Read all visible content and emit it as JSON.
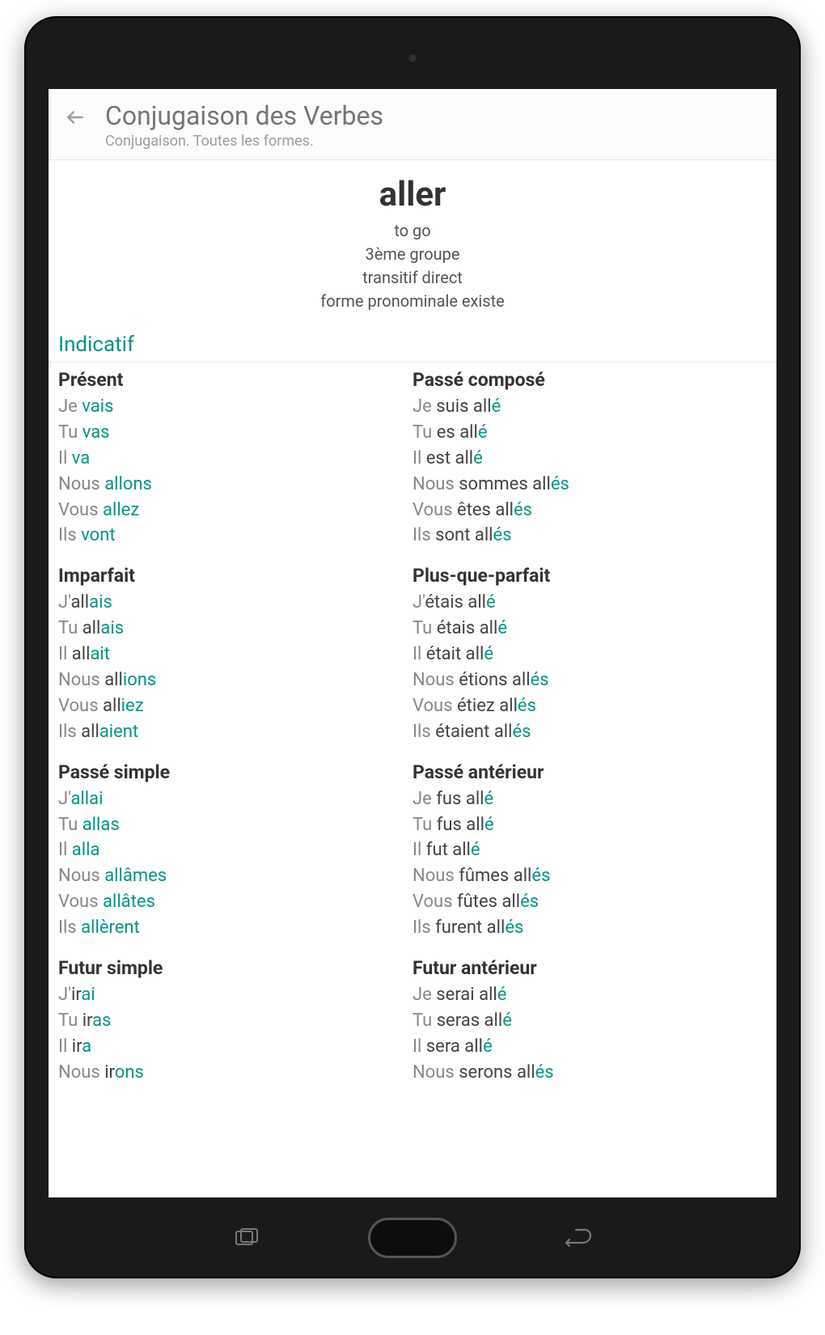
{
  "header": {
    "title": "Conjugaison des Verbes",
    "subtitle": "Conjugaison. Toutes les formes."
  },
  "verb": {
    "infinitive": "aller",
    "translation": "to go",
    "group": "3ème groupe",
    "transitivity": "transitif direct",
    "pronominal": "forme pronominale existe"
  },
  "mood": "Indicatif",
  "tenses": [
    {
      "left": {
        "name": "Présent",
        "rows": [
          {
            "pronoun": "Je",
            "parts": [
              {
                "t": "vais",
                "c": "verb-teal"
              }
            ]
          },
          {
            "pronoun": "Tu",
            "parts": [
              {
                "t": "vas",
                "c": "verb-teal"
              }
            ]
          },
          {
            "pronoun": "Il",
            "parts": [
              {
                "t": "va",
                "c": "verb-teal"
              }
            ]
          },
          {
            "pronoun": "Nous",
            "parts": [
              {
                "t": "allons",
                "c": "verb-teal"
              }
            ]
          },
          {
            "pronoun": "Vous",
            "parts": [
              {
                "t": "allez",
                "c": "verb-teal"
              }
            ]
          },
          {
            "pronoun": "Ils",
            "parts": [
              {
                "t": "vont",
                "c": "verb-teal"
              }
            ]
          }
        ]
      },
      "right": {
        "name": "Passé composé",
        "rows": [
          {
            "pronoun": "Je",
            "parts": [
              {
                "t": "suis",
                "c": "aux"
              },
              {
                "t": " all",
                "c": "stem"
              },
              {
                "t": "é",
                "c": "ending"
              }
            ]
          },
          {
            "pronoun": "Tu",
            "parts": [
              {
                "t": "es",
                "c": "aux"
              },
              {
                "t": " all",
                "c": "stem"
              },
              {
                "t": "é",
                "c": "ending"
              }
            ]
          },
          {
            "pronoun": "Il",
            "parts": [
              {
                "t": "est",
                "c": "aux"
              },
              {
                "t": " all",
                "c": "stem"
              },
              {
                "t": "é",
                "c": "ending"
              }
            ]
          },
          {
            "pronoun": "Nous",
            "parts": [
              {
                "t": "sommes",
                "c": "aux"
              },
              {
                "t": " all",
                "c": "stem"
              },
              {
                "t": "és",
                "c": "ending"
              }
            ]
          },
          {
            "pronoun": "Vous",
            "parts": [
              {
                "t": "êtes",
                "c": "aux"
              },
              {
                "t": " all",
                "c": "stem"
              },
              {
                "t": "és",
                "c": "ending"
              }
            ]
          },
          {
            "pronoun": "Ils",
            "parts": [
              {
                "t": "sont",
                "c": "aux"
              },
              {
                "t": " all",
                "c": "stem"
              },
              {
                "t": "és",
                "c": "ending"
              }
            ]
          }
        ]
      }
    },
    {
      "left": {
        "name": "Imparfait",
        "rows": [
          {
            "pronoun": "J'",
            "parts": [
              {
                "t": "all",
                "c": "stem"
              },
              {
                "t": "ais",
                "c": "ending"
              }
            ]
          },
          {
            "pronoun": "Tu",
            "parts": [
              {
                "t": "all",
                "c": "stem"
              },
              {
                "t": "ais",
                "c": "ending"
              }
            ]
          },
          {
            "pronoun": "Il",
            "parts": [
              {
                "t": "all",
                "c": "stem"
              },
              {
                "t": "ait",
                "c": "ending"
              }
            ]
          },
          {
            "pronoun": "Nous",
            "parts": [
              {
                "t": "all",
                "c": "stem"
              },
              {
                "t": "ions",
                "c": "ending"
              }
            ]
          },
          {
            "pronoun": "Vous",
            "parts": [
              {
                "t": "all",
                "c": "stem"
              },
              {
                "t": "iez",
                "c": "ending"
              }
            ]
          },
          {
            "pronoun": "Ils",
            "parts": [
              {
                "t": "all",
                "c": "stem"
              },
              {
                "t": "aient",
                "c": "ending"
              }
            ]
          }
        ]
      },
      "right": {
        "name": "Plus-que-parfait",
        "rows": [
          {
            "pronoun": "J'",
            "parts": [
              {
                "t": "étais",
                "c": "aux"
              },
              {
                "t": " all",
                "c": "stem"
              },
              {
                "t": "é",
                "c": "ending"
              }
            ]
          },
          {
            "pronoun": "Tu",
            "parts": [
              {
                "t": "étais",
                "c": "aux"
              },
              {
                "t": " all",
                "c": "stem"
              },
              {
                "t": "é",
                "c": "ending"
              }
            ]
          },
          {
            "pronoun": "Il",
            "parts": [
              {
                "t": "était",
                "c": "aux"
              },
              {
                "t": " all",
                "c": "stem"
              },
              {
                "t": "é",
                "c": "ending"
              }
            ]
          },
          {
            "pronoun": "Nous",
            "parts": [
              {
                "t": "étions",
                "c": "aux"
              },
              {
                "t": " all",
                "c": "stem"
              },
              {
                "t": "és",
                "c": "ending"
              }
            ]
          },
          {
            "pronoun": "Vous",
            "parts": [
              {
                "t": "étiez",
                "c": "aux"
              },
              {
                "t": " all",
                "c": "stem"
              },
              {
                "t": "és",
                "c": "ending"
              }
            ]
          },
          {
            "pronoun": "Ils",
            "parts": [
              {
                "t": "étaient",
                "c": "aux"
              },
              {
                "t": " all",
                "c": "stem"
              },
              {
                "t": "és",
                "c": "ending"
              }
            ]
          }
        ]
      }
    },
    {
      "left": {
        "name": "Passé simple",
        "rows": [
          {
            "pronoun": "J'",
            "parts": [
              {
                "t": "allai",
                "c": "verb-teal"
              }
            ]
          },
          {
            "pronoun": "Tu",
            "parts": [
              {
                "t": "allas",
                "c": "verb-teal"
              }
            ]
          },
          {
            "pronoun": "Il",
            "parts": [
              {
                "t": "alla",
                "c": "verb-teal"
              }
            ]
          },
          {
            "pronoun": "Nous",
            "parts": [
              {
                "t": "allâmes",
                "c": "verb-teal"
              }
            ]
          },
          {
            "pronoun": "Vous",
            "parts": [
              {
                "t": "allâtes",
                "c": "verb-teal"
              }
            ]
          },
          {
            "pronoun": "Ils",
            "parts": [
              {
                "t": "allèrent",
                "c": "verb-teal"
              }
            ]
          }
        ]
      },
      "right": {
        "name": "Passé antérieur",
        "rows": [
          {
            "pronoun": "Je",
            "parts": [
              {
                "t": "fus",
                "c": "aux"
              },
              {
                "t": " all",
                "c": "stem"
              },
              {
                "t": "é",
                "c": "ending"
              }
            ]
          },
          {
            "pronoun": "Tu",
            "parts": [
              {
                "t": "fus",
                "c": "aux"
              },
              {
                "t": " all",
                "c": "stem"
              },
              {
                "t": "é",
                "c": "ending"
              }
            ]
          },
          {
            "pronoun": "Il",
            "parts": [
              {
                "t": "fut",
                "c": "aux"
              },
              {
                "t": " all",
                "c": "stem"
              },
              {
                "t": "é",
                "c": "ending"
              }
            ]
          },
          {
            "pronoun": "Nous",
            "parts": [
              {
                "t": "fûmes",
                "c": "aux"
              },
              {
                "t": " all",
                "c": "stem"
              },
              {
                "t": "és",
                "c": "ending"
              }
            ]
          },
          {
            "pronoun": "Vous",
            "parts": [
              {
                "t": "fûtes",
                "c": "aux"
              },
              {
                "t": " all",
                "c": "stem"
              },
              {
                "t": "és",
                "c": "ending"
              }
            ]
          },
          {
            "pronoun": "Ils",
            "parts": [
              {
                "t": "furent",
                "c": "aux"
              },
              {
                "t": " all",
                "c": "stem"
              },
              {
                "t": "és",
                "c": "ending"
              }
            ]
          }
        ]
      }
    },
    {
      "left": {
        "name": "Futur simple",
        "rows": [
          {
            "pronoun": "J'",
            "parts": [
              {
                "t": "ir",
                "c": "stem"
              },
              {
                "t": "ai",
                "c": "ending"
              }
            ]
          },
          {
            "pronoun": "Tu",
            "parts": [
              {
                "t": "ir",
                "c": "stem"
              },
              {
                "t": "as",
                "c": "ending"
              }
            ]
          },
          {
            "pronoun": "Il",
            "parts": [
              {
                "t": "ir",
                "c": "stem"
              },
              {
                "t": "a",
                "c": "ending"
              }
            ]
          },
          {
            "pronoun": "Nous",
            "parts": [
              {
                "t": "ir",
                "c": "stem"
              },
              {
                "t": "ons",
                "c": "ending"
              }
            ]
          }
        ]
      },
      "right": {
        "name": "Futur antérieur",
        "rows": [
          {
            "pronoun": "Je",
            "parts": [
              {
                "t": "serai",
                "c": "aux"
              },
              {
                "t": " all",
                "c": "stem"
              },
              {
                "t": "é",
                "c": "ending"
              }
            ]
          },
          {
            "pronoun": "Tu",
            "parts": [
              {
                "t": "seras",
                "c": "aux"
              },
              {
                "t": " all",
                "c": "stem"
              },
              {
                "t": "é",
                "c": "ending"
              }
            ]
          },
          {
            "pronoun": "Il",
            "parts": [
              {
                "t": "sera",
                "c": "aux"
              },
              {
                "t": " all",
                "c": "stem"
              },
              {
                "t": "é",
                "c": "ending"
              }
            ]
          },
          {
            "pronoun": "Nous",
            "parts": [
              {
                "t": "serons",
                "c": "aux"
              },
              {
                "t": " all",
                "c": "stem"
              },
              {
                "t": "és",
                "c": "ending"
              }
            ]
          }
        ]
      }
    }
  ]
}
